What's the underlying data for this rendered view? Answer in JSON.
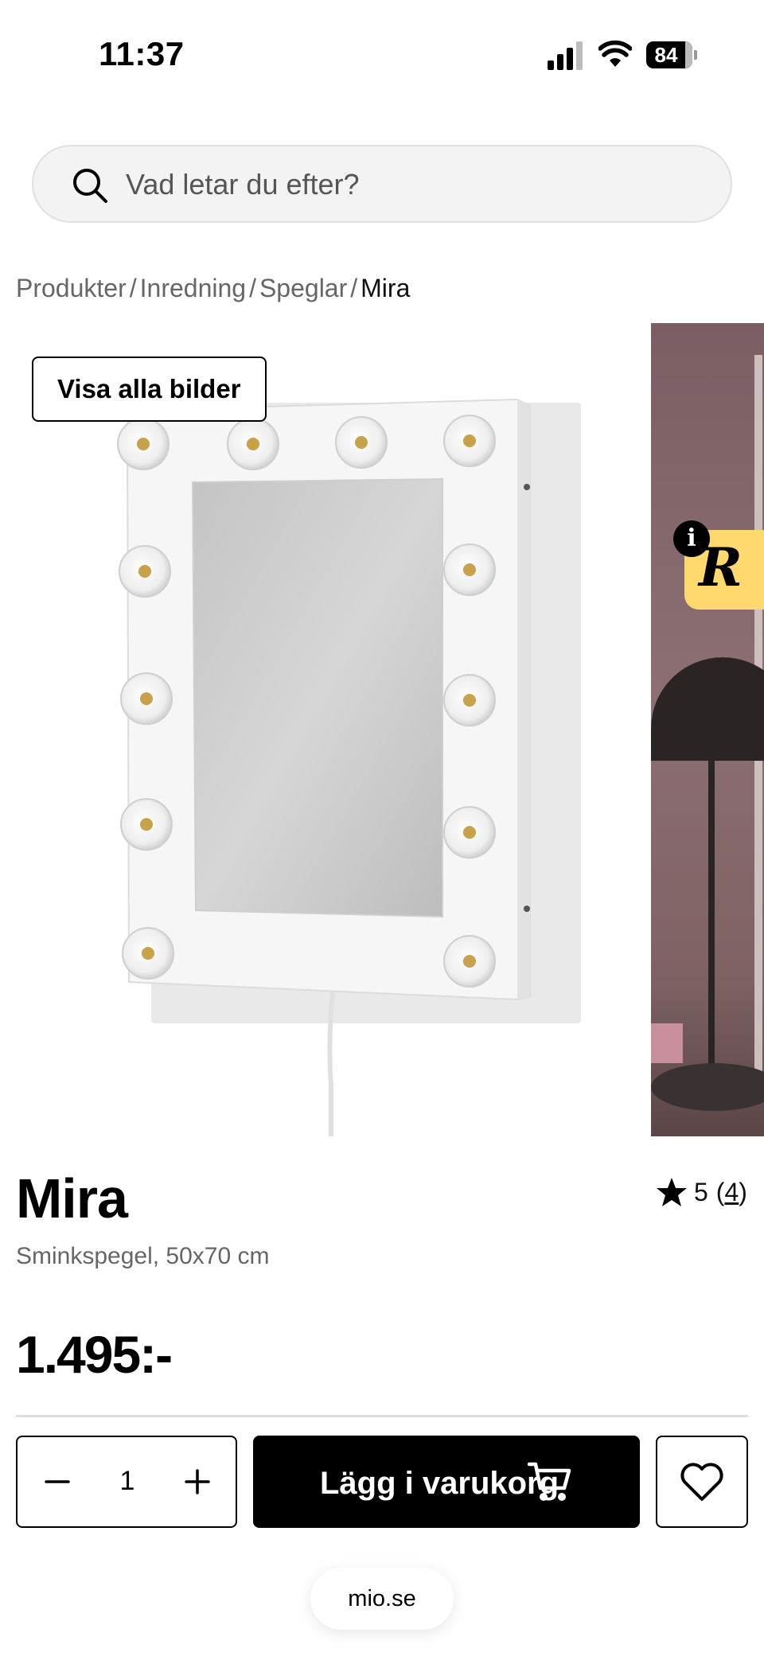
{
  "status_bar": {
    "time": "11:37",
    "battery": "84",
    "battery_level": 0.84
  },
  "search": {
    "placeholder": "Vad letar du efter?"
  },
  "breadcrumb": {
    "items": [
      "Produkter",
      "Inredning",
      "Speglar"
    ],
    "separator": "/",
    "current": "Mira"
  },
  "gallery": {
    "show_all_label": "Visa alla bilder",
    "badge_letter": "R",
    "info_letter": "i"
  },
  "product": {
    "title": "Mira",
    "subtitle": "Sminkspegel, 50x70 cm",
    "price": "1.495:-",
    "rating_value": "5",
    "rating_count": "4",
    "rating_open": "(",
    "rating_close": ")"
  },
  "cart": {
    "quantity": "1",
    "add_label": "Lägg i varukorg"
  },
  "browser": {
    "url": "mio.se"
  },
  "colors": {
    "badge": "#ffd86e",
    "primary": "#000000",
    "search_bg": "#f3f3f3"
  }
}
